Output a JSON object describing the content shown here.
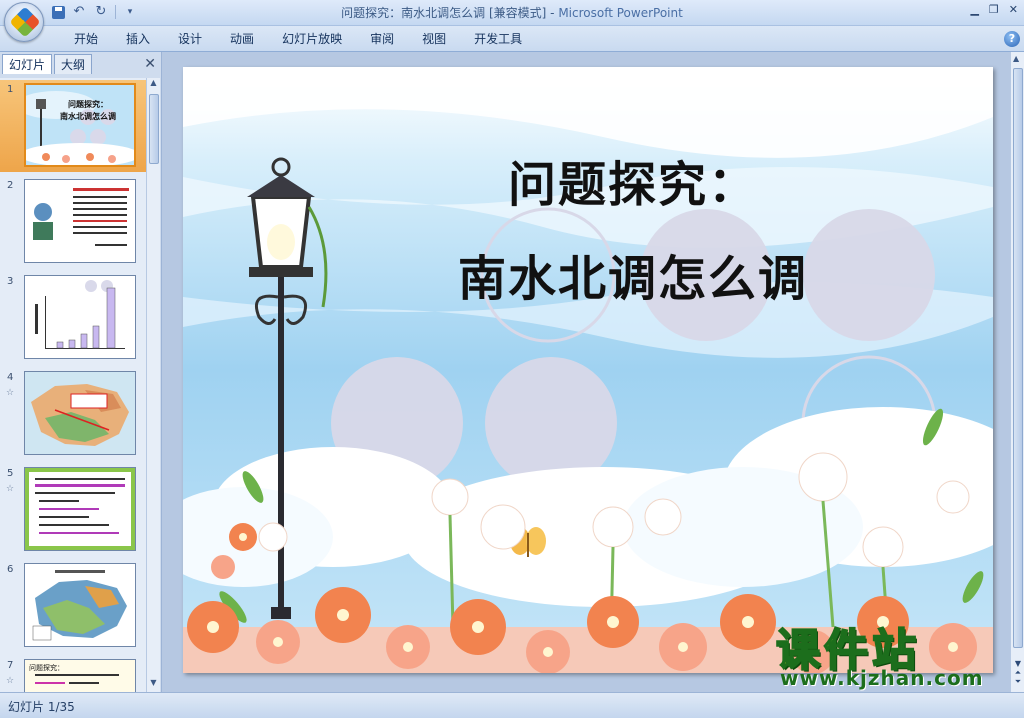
{
  "window": {
    "title": "问题探究：南水北调怎么调 [兼容模式] - ",
    "app_name": "Microsoft PowerPoint"
  },
  "ribbon": {
    "tabs": [
      "开始",
      "插入",
      "设计",
      "动画",
      "幻灯片放映",
      "审阅",
      "视图",
      "开发工具"
    ]
  },
  "left_panel": {
    "tab_slides": "幻灯片",
    "tab_outline": "大纲",
    "slides": [
      {
        "num": "1",
        "selected": true,
        "thumb_title": "问题探究：",
        "thumb_subtitle": "南水北调怎么调"
      },
      {
        "num": "2",
        "selected": false
      },
      {
        "num": "3",
        "selected": false
      },
      {
        "num": "4",
        "selected": false
      },
      {
        "num": "5",
        "selected": false
      },
      {
        "num": "6",
        "selected": false
      },
      {
        "num": "7",
        "selected": false,
        "thumb_title": "问题探究："
      }
    ]
  },
  "slide": {
    "title": "问题探究：",
    "subtitle": "南水北调怎么调"
  },
  "watermark": {
    "cn": "课件站",
    "url": "www.kjzhan.com"
  },
  "statusbar": {
    "slide_counter": "幻灯片 1/35"
  },
  "colors": {
    "ribbon_bg": "#c9daf0",
    "selected_thumb": "#eea54a",
    "sky": "#a9d6f2",
    "circle": "#d6d6e6"
  }
}
